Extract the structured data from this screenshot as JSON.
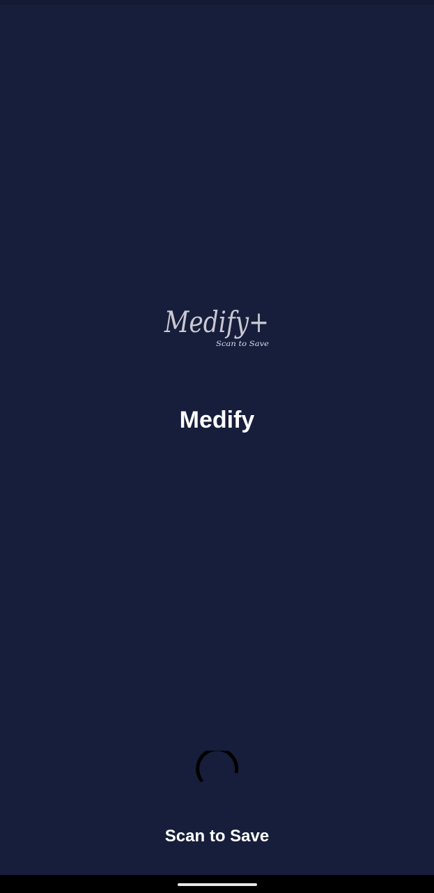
{
  "logo": {
    "wordmark": "Medify+",
    "tagline": "Scan to Save"
  },
  "app_title": "Medify",
  "loading_text": "Scan to Save",
  "icons": {
    "spinner": "loading-spinner-icon"
  },
  "colors": {
    "background": "#171e3b",
    "text": "#ffffff",
    "spinner": "#000000",
    "logo_text": "#c9c9d2"
  }
}
